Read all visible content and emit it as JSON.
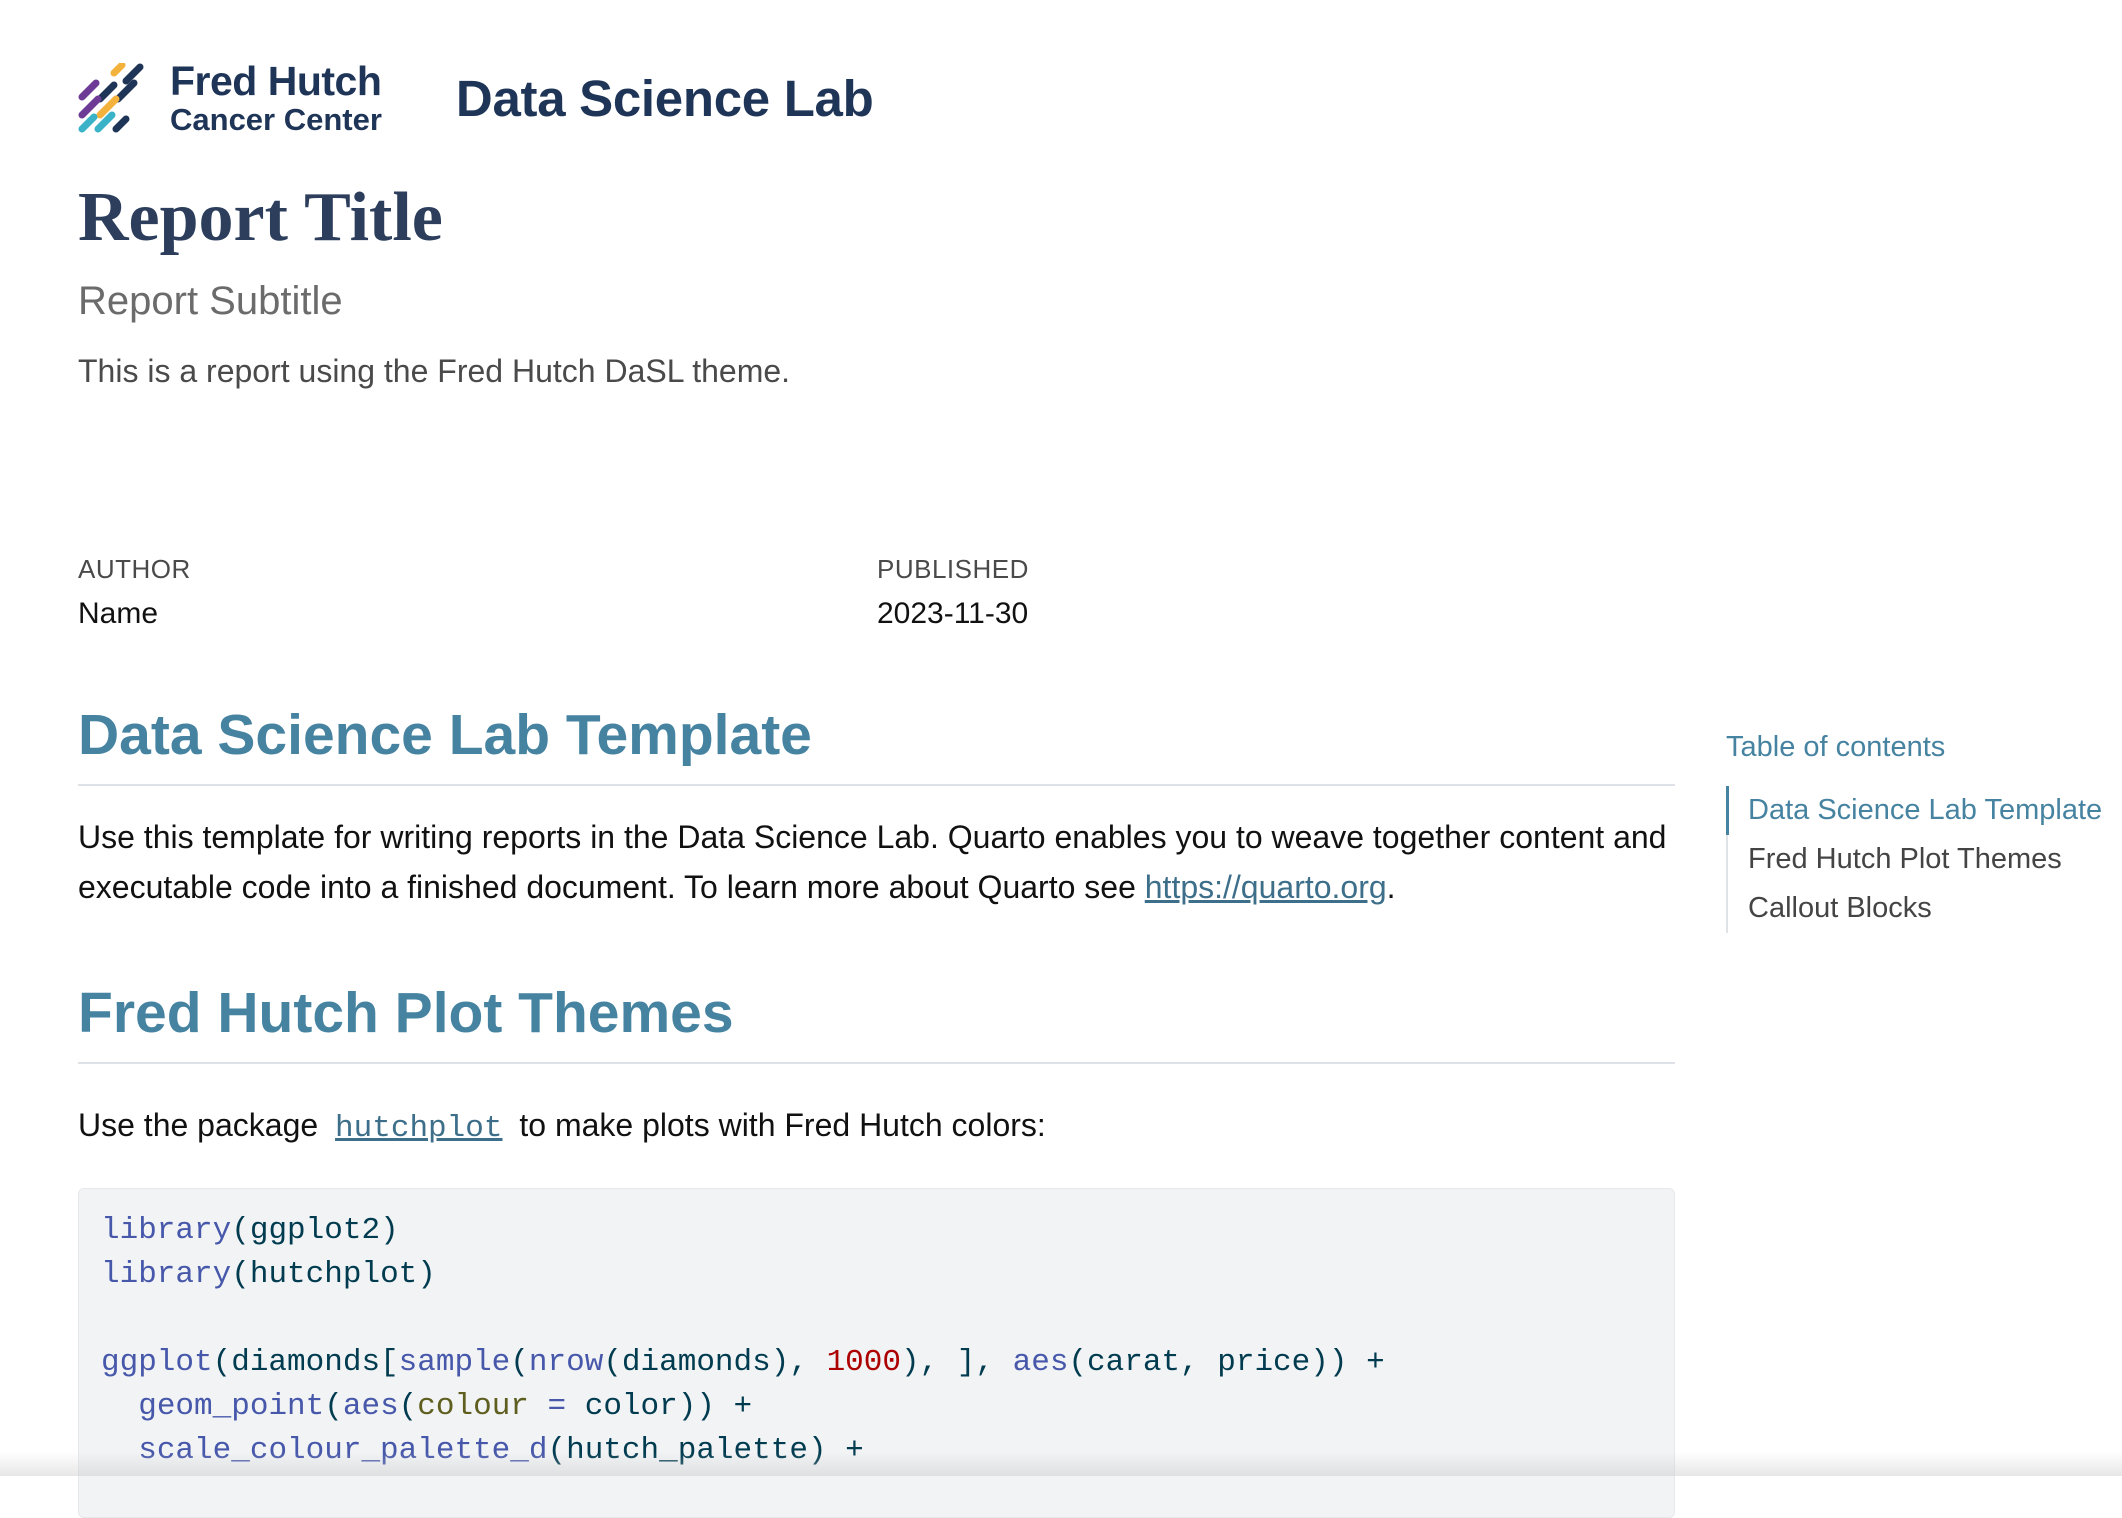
{
  "header": {
    "logo_line1": "Fred Hutch",
    "logo_line2": "Cancer Center",
    "lab_name": "Data Science Lab",
    "logo_colors": [
      "#6d3b96",
      "#f3b23c",
      "#3ab3c9",
      "#1f3557"
    ]
  },
  "report": {
    "title": "Report Title",
    "subtitle": "Report Subtitle",
    "description": "This is a report using the Fred Hutch DaSL theme."
  },
  "meta": {
    "author_label": "AUTHOR",
    "author_value": "Name",
    "published_label": "PUBLISHED",
    "published_value": "2023-11-30"
  },
  "sections": {
    "s1": {
      "heading": "Data Science Lab Template",
      "text_before_link": "Use this template for writing reports in the Data Science Lab. Quarto enables you to weave together content and executable code into a finished document. To learn more about Quarto see ",
      "link": "https://quarto.org",
      "text_after_link": "."
    },
    "s2": {
      "heading": "Fred Hutch Plot Themes",
      "text_before": "Use the package",
      "package": "hutchplot",
      "text_after": "to make plots with Fred Hutch colors:"
    }
  },
  "code": {
    "l1_fn": "library",
    "l1_arg": "ggplot2",
    "l2_fn": "library",
    "l2_arg": "hutchplot",
    "l4_fn": "ggplot",
    "l4_a": "(diamonds[",
    "l4_fn2": "sample",
    "l4_p1": "(",
    "l4_fn3": "nrow",
    "l4_p2": "(diamonds), ",
    "l4_num": "1000",
    "l4_p3": "), ], ",
    "l4_fn4": "aes",
    "l4_p4": "(carat, price)) +",
    "l5_fn": "geom_point",
    "l5_p1": "(",
    "l5_fn2": "aes",
    "l5_p2": "(",
    "l5_arg": "colour",
    "l5_eq": " = ",
    "l5_p3": "color)) +",
    "l6_fn": "scale_colour_palette_d",
    "l6_p1": "(hutch_palette) +"
  },
  "toc": {
    "title": "Table of contents",
    "items": [
      "Data Science Lab Template",
      "Fred Hutch Plot Themes",
      "Callout Blocks"
    ]
  }
}
